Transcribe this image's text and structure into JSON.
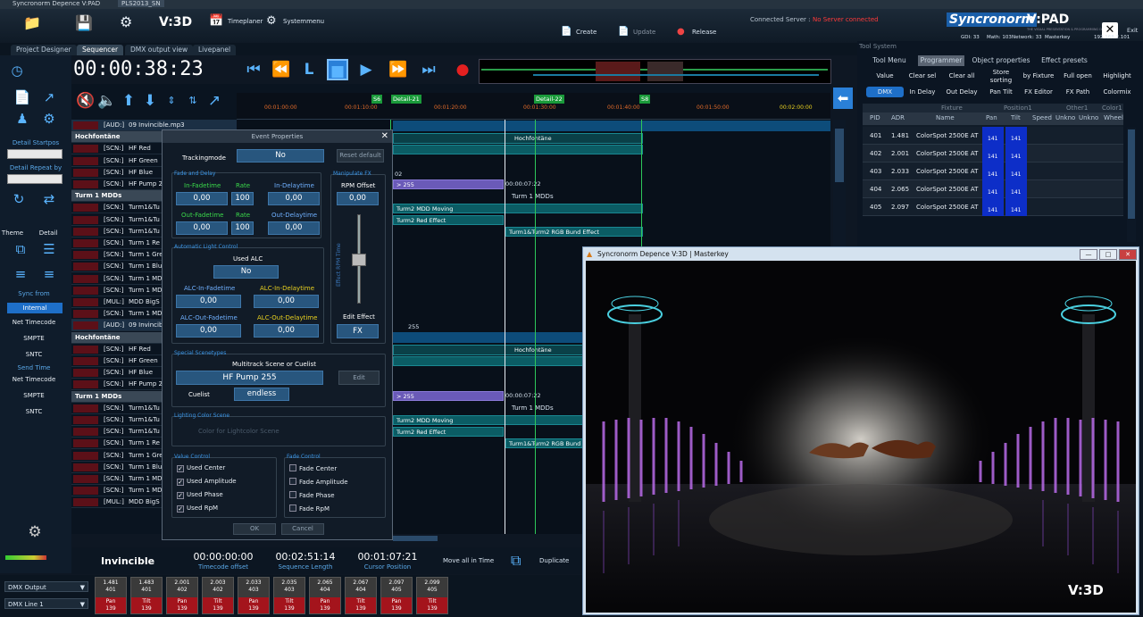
{
  "titlebar": {
    "title": "Syncronorm Depence V:PAD",
    "tab": "PLS2013_SN"
  },
  "menubar": {
    "v3d": "V:3D",
    "timeplaner": "Timeplaner",
    "systemmenu": "Systemmenu",
    "create": "Create",
    "update": "Update",
    "release": "Release",
    "connected_label": "Connected Server :",
    "connected_value": "No Server connected",
    "brand": "Syncronorm",
    "product": "V:PAD",
    "tagline": "THE VISUAL PRESENTATION & PROGRAMMING DESK",
    "exit": "Exit",
    "status": {
      "gdi": "GDI: 33",
      "math": "Math: 103",
      "network": "Network: 33",
      "mode": "Masterkey",
      "ip": "192.168.2.101"
    }
  },
  "tabs": [
    "Project Designer",
    "Sequencer",
    "DMX output view",
    "Livepanel"
  ],
  "timecode": "00:00:38:23",
  "left": {
    "detail_startpos": "Detail Startpos",
    "detail_repeat": "Detail Repeat by",
    "theme": "Theme",
    "detail": "Detail",
    "sync_from": "Sync from",
    "internal": "Internal",
    "net_timecode": "Net Timecode",
    "smpte": "SMPTE",
    "sntc": "SNTC",
    "send_time": "Send Time",
    "net_timecode2": "Net Timecode",
    "smpte2": "SMPTE",
    "sntc2": "SNTC"
  },
  "ruler": {
    "t1": "00:01:00:00",
    "t2": "00:01:10:00",
    "t3": "00:01:20:00",
    "t4": "00:01:30:00",
    "t5": "00:01:40:00",
    "t6": "00:01:50:00",
    "t7": "00:02:00:00",
    "m1": "S6",
    "m2": "Detail-21",
    "m3": "Detail-22",
    "m4": "S8"
  },
  "tracks": [
    {
      "label": "[AUD:]",
      "name": "09 Invincible.mp3",
      "kind": "aud"
    },
    {
      "label": "Hochfontäne",
      "name": "",
      "kind": "grp"
    },
    {
      "label": "[SCN:]",
      "name": "HF Red",
      "kind": "row"
    },
    {
      "label": "[SCN:]",
      "name": "HF Green",
      "kind": "row"
    },
    {
      "label": "[SCN:]",
      "name": "HF Blue",
      "kind": "row"
    },
    {
      "label": "[SCN:]",
      "name": "HF Pump 2",
      "kind": "row"
    },
    {
      "label": "Turm 1 MDDs",
      "name": "",
      "kind": "grp"
    },
    {
      "label": "[SCN:]",
      "name": "Turm1&Tu",
      "kind": "row"
    },
    {
      "label": "[SCN:]",
      "name": "Turm1&Tu",
      "kind": "row"
    },
    {
      "label": "[SCN:]",
      "name": "Turm1&Tu",
      "kind": "row"
    },
    {
      "label": "[SCN:]",
      "name": "Turm 1 Re",
      "kind": "row"
    },
    {
      "label": "[SCN:]",
      "name": "Turm 1 Gre",
      "kind": "row"
    },
    {
      "label": "[SCN:]",
      "name": "Turm 1 Blu",
      "kind": "row"
    },
    {
      "label": "[SCN:]",
      "name": "Turm 1 MD",
      "kind": "row"
    },
    {
      "label": "[SCN:]",
      "name": "Turm 1 MD",
      "kind": "row"
    },
    {
      "label": "[MUL:]",
      "name": "MDD BigS",
      "kind": "row"
    },
    {
      "label": "[SCN:]",
      "name": "Turm 1 MD",
      "kind": "row"
    },
    {
      "label": "[AUD:]",
      "name": "09 Invincib",
      "kind": "aud"
    },
    {
      "label": "Hochfontäne",
      "name": "",
      "kind": "grp"
    },
    {
      "label": "[SCN:]",
      "name": "HF Red",
      "kind": "row"
    },
    {
      "label": "[SCN:]",
      "name": "HF Green",
      "kind": "row"
    },
    {
      "label": "[SCN:]",
      "name": "HF Blue",
      "kind": "row"
    },
    {
      "label": "[SCN:]",
      "name": "HF Pump 2",
      "kind": "row"
    },
    {
      "label": "Turm 1 MDDs",
      "name": "",
      "kind": "grp"
    },
    {
      "label": "[SCN:]",
      "name": "Turm1&Tu",
      "kind": "row"
    },
    {
      "label": "[SCN:]",
      "name": "Turm1&Tu",
      "kind": "row"
    },
    {
      "label": "[SCN:]",
      "name": "Turm1&Tu",
      "kind": "row"
    },
    {
      "label": "[SCN:]",
      "name": "Turm 1 Re",
      "kind": "row"
    },
    {
      "label": "[SCN:]",
      "name": "Turm 1 Gre",
      "kind": "row"
    },
    {
      "label": "[SCN:]",
      "name": "Turm 1 Blu",
      "kind": "row"
    },
    {
      "label": "[SCN:]",
      "name": "Turm 1 MD",
      "kind": "row"
    },
    {
      "label": "[SCN:]",
      "name": "Turm 1 MD",
      "kind": "row"
    },
    {
      "label": "[MUL:]",
      "name": "MDD BigS",
      "kind": "row"
    }
  ],
  "clips": {
    "hochfontane": "Hochfontäne",
    "c255": "> 255",
    "t1": "00:00:07:22",
    "turm1": "Turm 1 MDDs",
    "moving": "Turm2 MDD Moving",
    "red": "Turm2 Red Effect",
    "rgb": "Turm1&Turm2 RGB Bund Effect",
    "rgb_short": "Turm1&Turm2 RGB Bund",
    "num02": "02",
    "num255": "255"
  },
  "dialog": {
    "title": "Event Properties",
    "tracking_label": "Trackingmode",
    "tracking": "No",
    "reset": "Reset default",
    "fade_title": "Fade and Delay",
    "in_fadetime": "In-Fadetime",
    "rate": "Rate",
    "in_delaytime": "In-Delaytime",
    "out_fadetime": "Out-Fadetime",
    "rate2": "Rate",
    "out_delaytime": "Out-Delaytime",
    "v_infade": "0,00",
    "v_rate1": "100",
    "v_indelay": "0,00",
    "v_outfade": "0,00",
    "v_rate2": "100",
    "v_outdelay": "0,00",
    "manip_title": "Manipulate FX",
    "rpm_offset": "RPM Offset",
    "rpm_val": "0,00",
    "fader_label": "Effect RPM Time",
    "edit_effect": "Edit Effect",
    "fx": "FX",
    "alc_title": "Automatic Light Control",
    "used_alc": "Used ALC",
    "used_alc_val": "No",
    "alc_in_fade": "ALC-In-Fadetime",
    "alc_in_delay": "ALC-In-Delaytime",
    "alc_out_fade": "ALC-Out-Fadetime",
    "alc_out_delay": "ALC-Out-Delaytime",
    "v_alc1": "0,00",
    "v_alc2": "0,00",
    "v_alc3": "0,00",
    "v_alc4": "0,00",
    "special_title": "Special Scenetypes",
    "multitrack": "Multitrack Scene or Cuelist",
    "scene_val": "HF Pump 255",
    "edit": "Edit",
    "cuelist": "Cuelist",
    "cuelist_val": "endless",
    "lighting_title": "Lighting Color Scene",
    "lighting_val": "Color for Lightcolor Scene",
    "value_title": "Value Control",
    "fade_title2": "Fade Control",
    "chk": [
      "Used Center",
      "Used Amplitude",
      "Used Phase",
      "Used RpM"
    ],
    "fchk": [
      "Fade Center",
      "Fade Amplitude",
      "Fade Phase",
      "Fade RpM"
    ],
    "ok": "OK",
    "cancel": "Cancel"
  },
  "bottom": {
    "name": "Invincible",
    "tc_offset_val": "00:00:00:00",
    "tc_offset": "Timecode offset",
    "seq_len_val": "00:02:51:14",
    "seq_len": "Sequence Length",
    "cursor_val": "00:01:07:21",
    "cursor": "Cursor Position",
    "move_all": "Move all in Time",
    "duplicate": "Duplicate"
  },
  "dmx": {
    "output": "DMX Output",
    "line": "DMX Line 1",
    "cells": [
      {
        "v": "1.481",
        "a": "401",
        "ch": "Pan",
        "val": "139"
      },
      {
        "v": "1.483",
        "a": "401",
        "ch": "Tilt",
        "val": "139"
      },
      {
        "v": "2.001",
        "a": "402",
        "ch": "Pan",
        "val": "139"
      },
      {
        "v": "2.003",
        "a": "402",
        "ch": "Tilt",
        "val": "139"
      },
      {
        "v": "2.033",
        "a": "403",
        "ch": "Pan",
        "val": "139"
      },
      {
        "v": "2.035",
        "a": "403",
        "ch": "Tilt",
        "val": "139"
      },
      {
        "v": "2.065",
        "a": "404",
        "ch": "Pan",
        "val": "139"
      },
      {
        "v": "2.067",
        "a": "404",
        "ch": "Tilt",
        "val": "139"
      },
      {
        "v": "2.097",
        "a": "405",
        "ch": "Pan",
        "val": "139"
      },
      {
        "v": "2.099",
        "a": "405",
        "ch": "Tilt",
        "val": "139"
      }
    ]
  },
  "right": {
    "header": "Tool System",
    "tabs": [
      "Tool Menu",
      "Programmer",
      "Object properties",
      "Effect presets"
    ],
    "btns": [
      "Value",
      "Clear sel",
      "Clear all",
      "Store sorting",
      "by Fixture",
      "Full open",
      "Highlight"
    ],
    "btns2": [
      "DMX",
      "In Delay",
      "Out Delay",
      "Pan Tilt",
      "FX Editor",
      "FX Path",
      "Colormix"
    ],
    "group_hdrs": [
      "Fixture",
      "Position1",
      "Other1",
      "Color1"
    ],
    "cols": [
      "PID",
      "ADR",
      "Name",
      "Pan",
      "Tilt",
      "Speed",
      "Unkno",
      "Unkno",
      "Wheel"
    ],
    "rows": [
      {
        "pid": "401",
        "adr": "1.481",
        "name": "ColorSpot 2500E AT",
        "pan": "141",
        "tilt": "141"
      },
      {
        "pid": "402",
        "adr": "2.001",
        "name": "ColorSpot 2500E AT",
        "pan": "141",
        "tilt": "141"
      },
      {
        "pid": "403",
        "adr": "2.033",
        "name": "ColorSpot 2500E AT",
        "pan": "141",
        "tilt": "141"
      },
      {
        "pid": "404",
        "adr": "2.065",
        "name": "ColorSpot 2500E AT",
        "pan": "141",
        "tilt": "141"
      },
      {
        "pid": "405",
        "adr": "2.097",
        "name": "ColorSpot 2500E AT",
        "pan": "141",
        "tilt": "141"
      }
    ]
  },
  "video": {
    "title": "Syncronorm Depence V:3D | Masterkey",
    "logo": "V:3D"
  }
}
